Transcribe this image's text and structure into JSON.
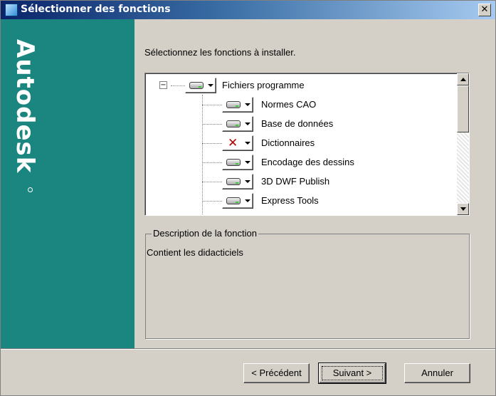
{
  "window": {
    "title": "Sélectionner des fonctions",
    "close_label": "✕"
  },
  "brand": {
    "logo_text": "Autodesk",
    "logo_color": "#ffffff",
    "panel_color": "#1b857f"
  },
  "prompt": "Sélectionnez les fonctions à installer.",
  "tree": {
    "root_label": "Fichiers programme",
    "root_state": "installed",
    "expander": "−",
    "children": [
      {
        "label": "Normes CAO",
        "state": "installed"
      },
      {
        "label": "Base de données",
        "state": "installed"
      },
      {
        "label": "Dictionnaires",
        "state": "not-installed"
      },
      {
        "label": "Encodage des dessins",
        "state": "installed"
      },
      {
        "label": "3D DWF Publish",
        "state": "installed"
      },
      {
        "label": "Express Tools",
        "state": "installed"
      }
    ]
  },
  "description": {
    "legend": "Description de la fonction",
    "text": "Contient les didacticiels"
  },
  "buttons": {
    "back": "< Précédent",
    "next": "Suivant >",
    "cancel": "Annuler"
  }
}
